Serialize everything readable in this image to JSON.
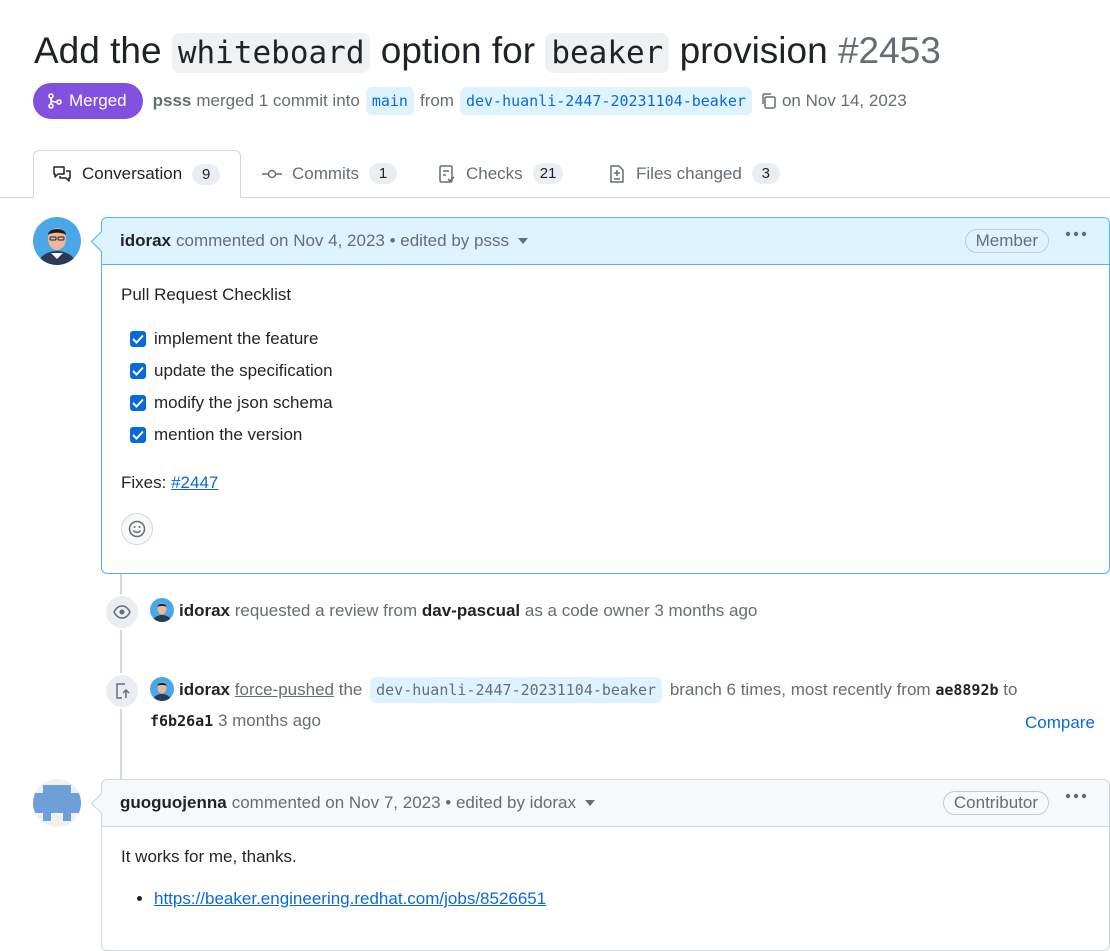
{
  "header": {
    "title_prefix": "Add the",
    "title_code1": "whiteboard",
    "title_mid": "option for",
    "title_code2": "beaker",
    "title_suffix": "provision",
    "pr_number": "#2453"
  },
  "meta": {
    "state": "Merged",
    "user": "psss",
    "action": "merged 1 commit into",
    "base_branch": "main",
    "from_word": "from",
    "head_branch": "dev-huanli-2447-20231104-beaker",
    "date": "on Nov 14, 2023"
  },
  "tabs": [
    {
      "label": "Conversation",
      "count": "9"
    },
    {
      "label": "Commits",
      "count": "1"
    },
    {
      "label": "Checks",
      "count": "21"
    },
    {
      "label": "Files changed",
      "count": "3"
    }
  ],
  "comment1": {
    "author": "idorax",
    "info": "commented on Nov 4, 2023 • edited by psss",
    "role": "Member",
    "heading": "Pull Request Checklist",
    "checklist": [
      "implement the feature",
      "update the specification",
      "modify the json schema",
      "mention the version"
    ],
    "fixes_label": "Fixes:",
    "fixes_link": "#2447"
  },
  "event1": {
    "author": "idorax",
    "text": "requested a review from",
    "reviewer": "dav-pascual",
    "suffix": "as a code owner 3 months ago"
  },
  "event2": {
    "author": "idorax",
    "action": "force-pushed",
    "the": "the",
    "branch": "dev-huanli-2447-20231104-beaker",
    "text": "branch 6 times, most recently from",
    "from_sha": "ae8892b",
    "to": "to",
    "to_sha": "f6b26a1",
    "time": "3 months ago",
    "compare": "Compare"
  },
  "comment2": {
    "author": "guoguojenna",
    "info": "commented on Nov 7, 2023 • edited by idorax",
    "role": "Contributor",
    "body": "It works for me, thanks.",
    "link": "https://beaker.engineering.redhat.com/jobs/8526651"
  },
  "colors": {
    "merged": "#8250df",
    "link": "#0969da",
    "highlight_bg": "#ddf4ff"
  }
}
